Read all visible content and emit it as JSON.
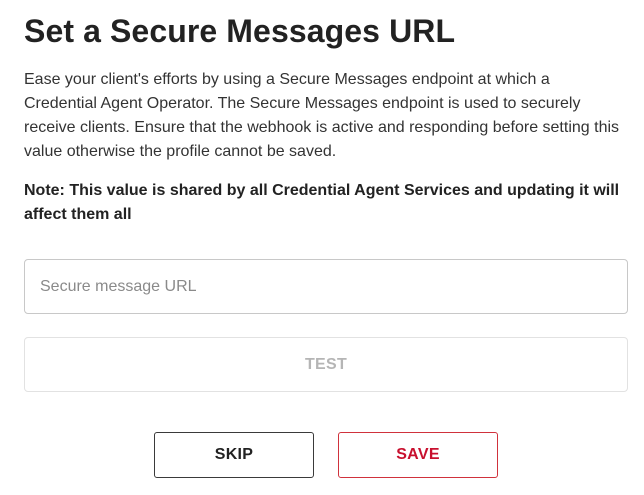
{
  "dialog": {
    "title": "Set a Secure Messages URL",
    "description": "Ease your client's efforts by using a Secure Messages endpoint at which a Credential Agent Operator. The Secure Messages endpoint is used to securely receive clients. Ensure that the webhook is active and responding before setting this value otherwise the profile cannot be saved.",
    "note": "Note: This value is shared by all Credential Agent Services and updating it will affect them all",
    "url_input": {
      "value": "",
      "placeholder": "Secure message URL"
    },
    "test_button": {
      "label": "TEST",
      "state": "disabled"
    },
    "skip_button": {
      "label": "SKIP"
    },
    "save_button": {
      "label": "SAVE"
    }
  },
  "colors": {
    "text": "#222222",
    "accent": "#c8102e",
    "disabled_text": "#b5b5b5",
    "border": "#c8c8c8"
  }
}
